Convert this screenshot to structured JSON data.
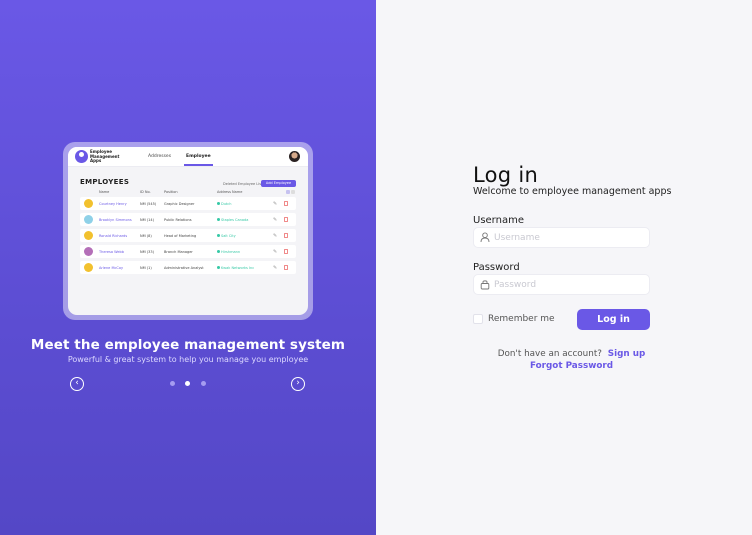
{
  "showcase": {
    "preview": {
      "app_name": "Employee Management Apps",
      "nav_tabs": [
        {
          "label": "Addresses",
          "active": false
        },
        {
          "label": "Employee",
          "active": true
        }
      ],
      "section_title": "EMPLOYEES",
      "deleted_link": "Deleted Employee List",
      "add_button": "Add Employee",
      "columns": [
        "Name",
        "ID No.",
        "Position",
        "Address Name"
      ],
      "rows": [
        {
          "name": "Courtney Henry",
          "id": "NM (545)",
          "position": "Graphic Designer",
          "address": "Dutch",
          "avatar_color": "#f2c12e"
        },
        {
          "name": "Brooklyn Simmons",
          "id": "NM (14)",
          "position": "Public Relations",
          "address": "Staples Canada",
          "avatar_color": "#8fd1e8"
        },
        {
          "name": "Ronald Richards",
          "id": "NM (8)",
          "position": "Head of Marketing",
          "address": "Salt City",
          "avatar_color": "#f2c12e"
        },
        {
          "name": "Theresa Webb",
          "id": "NM (33)",
          "position": "Branch Manager",
          "address": "Hirshmann",
          "avatar_color": "#b46fb8"
        },
        {
          "name": "Arlene McCoy",
          "id": "NM (1)",
          "position": "Administrative Analyst",
          "address": "Kwak Networks Inc",
          "avatar_color": "#f2c12e"
        }
      ]
    },
    "headline": "Meet the employee management system",
    "subline": "Powerful &  great system to help you manage you employee",
    "prev_icon": "chevron-left-circle-icon",
    "next_icon": "chevron-right-circle-icon",
    "carousel": {
      "total": 3,
      "active_index": 2
    }
  },
  "login": {
    "title": "Log in",
    "subtitle": "Welcome to employee management apps",
    "username_label": "Username",
    "username_placeholder": "Username",
    "username_value": "",
    "password_label": "Password",
    "password_placeholder": "Password",
    "password_value": "",
    "remember_label": "Remember me",
    "remember_checked": false,
    "submit_label": "Log in",
    "no_account_text": "Don't have an account?",
    "signup_link": "Sign up",
    "forgot_link": "Forgot Password"
  },
  "colors": {
    "accent": "#6a58e6",
    "panel_top": "#6a58e6",
    "panel_bottom": "#5447c6",
    "background": "#f6f6f9",
    "address_green": "#36c9a6"
  }
}
